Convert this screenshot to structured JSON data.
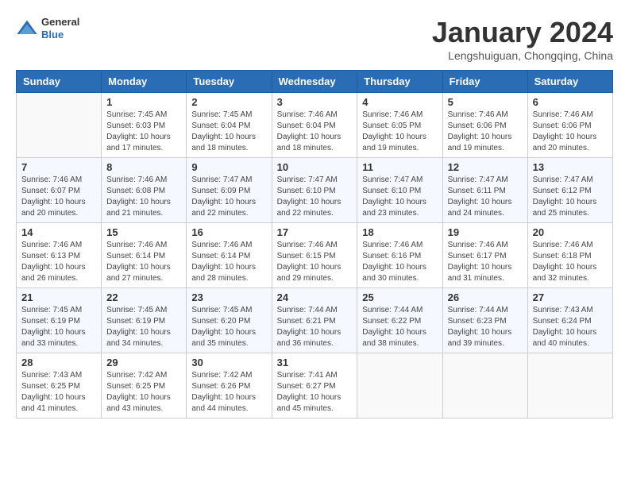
{
  "header": {
    "logo": {
      "general": "General",
      "blue": "Blue"
    },
    "title": "January 2024",
    "location": "Lengshuiguan, Chongqing, China"
  },
  "columns": [
    "Sunday",
    "Monday",
    "Tuesday",
    "Wednesday",
    "Thursday",
    "Friday",
    "Saturday"
  ],
  "weeks": [
    [
      {
        "day": "",
        "sunrise": "",
        "sunset": "",
        "daylight": ""
      },
      {
        "day": "1",
        "sunrise": "Sunrise: 7:45 AM",
        "sunset": "Sunset: 6:03 PM",
        "daylight": "Daylight: 10 hours and 17 minutes."
      },
      {
        "day": "2",
        "sunrise": "Sunrise: 7:45 AM",
        "sunset": "Sunset: 6:04 PM",
        "daylight": "Daylight: 10 hours and 18 minutes."
      },
      {
        "day": "3",
        "sunrise": "Sunrise: 7:46 AM",
        "sunset": "Sunset: 6:04 PM",
        "daylight": "Daylight: 10 hours and 18 minutes."
      },
      {
        "day": "4",
        "sunrise": "Sunrise: 7:46 AM",
        "sunset": "Sunset: 6:05 PM",
        "daylight": "Daylight: 10 hours and 19 minutes."
      },
      {
        "day": "5",
        "sunrise": "Sunrise: 7:46 AM",
        "sunset": "Sunset: 6:06 PM",
        "daylight": "Daylight: 10 hours and 19 minutes."
      },
      {
        "day": "6",
        "sunrise": "Sunrise: 7:46 AM",
        "sunset": "Sunset: 6:06 PM",
        "daylight": "Daylight: 10 hours and 20 minutes."
      }
    ],
    [
      {
        "day": "7",
        "sunrise": "Sunrise: 7:46 AM",
        "sunset": "Sunset: 6:07 PM",
        "daylight": "Daylight: 10 hours and 20 minutes."
      },
      {
        "day": "8",
        "sunrise": "Sunrise: 7:46 AM",
        "sunset": "Sunset: 6:08 PM",
        "daylight": "Daylight: 10 hours and 21 minutes."
      },
      {
        "day": "9",
        "sunrise": "Sunrise: 7:47 AM",
        "sunset": "Sunset: 6:09 PM",
        "daylight": "Daylight: 10 hours and 22 minutes."
      },
      {
        "day": "10",
        "sunrise": "Sunrise: 7:47 AM",
        "sunset": "Sunset: 6:10 PM",
        "daylight": "Daylight: 10 hours and 22 minutes."
      },
      {
        "day": "11",
        "sunrise": "Sunrise: 7:47 AM",
        "sunset": "Sunset: 6:10 PM",
        "daylight": "Daylight: 10 hours and 23 minutes."
      },
      {
        "day": "12",
        "sunrise": "Sunrise: 7:47 AM",
        "sunset": "Sunset: 6:11 PM",
        "daylight": "Daylight: 10 hours and 24 minutes."
      },
      {
        "day": "13",
        "sunrise": "Sunrise: 7:47 AM",
        "sunset": "Sunset: 6:12 PM",
        "daylight": "Daylight: 10 hours and 25 minutes."
      }
    ],
    [
      {
        "day": "14",
        "sunrise": "Sunrise: 7:46 AM",
        "sunset": "Sunset: 6:13 PM",
        "daylight": "Daylight: 10 hours and 26 minutes."
      },
      {
        "day": "15",
        "sunrise": "Sunrise: 7:46 AM",
        "sunset": "Sunset: 6:14 PM",
        "daylight": "Daylight: 10 hours and 27 minutes."
      },
      {
        "day": "16",
        "sunrise": "Sunrise: 7:46 AM",
        "sunset": "Sunset: 6:14 PM",
        "daylight": "Daylight: 10 hours and 28 minutes."
      },
      {
        "day": "17",
        "sunrise": "Sunrise: 7:46 AM",
        "sunset": "Sunset: 6:15 PM",
        "daylight": "Daylight: 10 hours and 29 minutes."
      },
      {
        "day": "18",
        "sunrise": "Sunrise: 7:46 AM",
        "sunset": "Sunset: 6:16 PM",
        "daylight": "Daylight: 10 hours and 30 minutes."
      },
      {
        "day": "19",
        "sunrise": "Sunrise: 7:46 AM",
        "sunset": "Sunset: 6:17 PM",
        "daylight": "Daylight: 10 hours and 31 minutes."
      },
      {
        "day": "20",
        "sunrise": "Sunrise: 7:46 AM",
        "sunset": "Sunset: 6:18 PM",
        "daylight": "Daylight: 10 hours and 32 minutes."
      }
    ],
    [
      {
        "day": "21",
        "sunrise": "Sunrise: 7:45 AM",
        "sunset": "Sunset: 6:19 PM",
        "daylight": "Daylight: 10 hours and 33 minutes."
      },
      {
        "day": "22",
        "sunrise": "Sunrise: 7:45 AM",
        "sunset": "Sunset: 6:19 PM",
        "daylight": "Daylight: 10 hours and 34 minutes."
      },
      {
        "day": "23",
        "sunrise": "Sunrise: 7:45 AM",
        "sunset": "Sunset: 6:20 PM",
        "daylight": "Daylight: 10 hours and 35 minutes."
      },
      {
        "day": "24",
        "sunrise": "Sunrise: 7:44 AM",
        "sunset": "Sunset: 6:21 PM",
        "daylight": "Daylight: 10 hours and 36 minutes."
      },
      {
        "day": "25",
        "sunrise": "Sunrise: 7:44 AM",
        "sunset": "Sunset: 6:22 PM",
        "daylight": "Daylight: 10 hours and 38 minutes."
      },
      {
        "day": "26",
        "sunrise": "Sunrise: 7:44 AM",
        "sunset": "Sunset: 6:23 PM",
        "daylight": "Daylight: 10 hours and 39 minutes."
      },
      {
        "day": "27",
        "sunrise": "Sunrise: 7:43 AM",
        "sunset": "Sunset: 6:24 PM",
        "daylight": "Daylight: 10 hours and 40 minutes."
      }
    ],
    [
      {
        "day": "28",
        "sunrise": "Sunrise: 7:43 AM",
        "sunset": "Sunset: 6:25 PM",
        "daylight": "Daylight: 10 hours and 41 minutes."
      },
      {
        "day": "29",
        "sunrise": "Sunrise: 7:42 AM",
        "sunset": "Sunset: 6:25 PM",
        "daylight": "Daylight: 10 hours and 43 minutes."
      },
      {
        "day": "30",
        "sunrise": "Sunrise: 7:42 AM",
        "sunset": "Sunset: 6:26 PM",
        "daylight": "Daylight: 10 hours and 44 minutes."
      },
      {
        "day": "31",
        "sunrise": "Sunrise: 7:41 AM",
        "sunset": "Sunset: 6:27 PM",
        "daylight": "Daylight: 10 hours and 45 minutes."
      },
      {
        "day": "",
        "sunrise": "",
        "sunset": "",
        "daylight": ""
      },
      {
        "day": "",
        "sunrise": "",
        "sunset": "",
        "daylight": ""
      },
      {
        "day": "",
        "sunrise": "",
        "sunset": "",
        "daylight": ""
      }
    ]
  ]
}
